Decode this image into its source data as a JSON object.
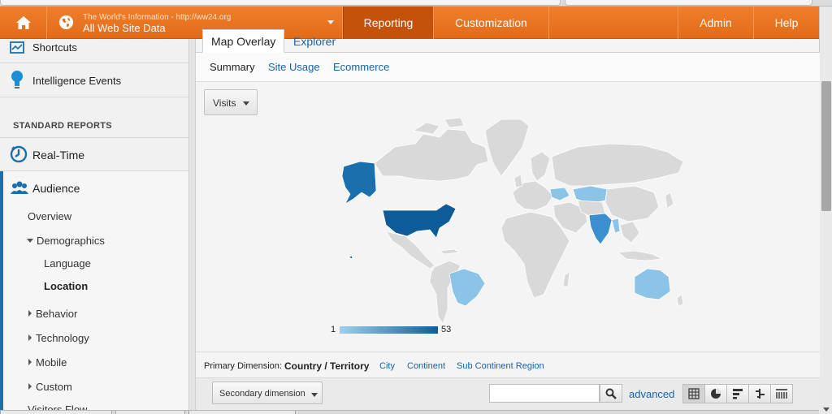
{
  "header": {
    "account_url": "The World's Information - http://ww24.org",
    "account_name": "All Web Site Data",
    "tabs": [
      {
        "label": "Reporting",
        "active": true
      },
      {
        "label": "Customization",
        "active": false
      }
    ],
    "right_tabs": [
      {
        "label": "Admin"
      },
      {
        "label": "Help"
      }
    ],
    "accent_color": "#e8731f",
    "active_tab_color": "#c4520a"
  },
  "sidebar": {
    "shortcuts": "Shortcuts",
    "intelligence_events": "Intelligence Events",
    "section_title": "STANDARD REPORTS",
    "realtime": "Real-Time",
    "audience": "Audience",
    "audience_items": {
      "overview": "Overview",
      "demographics": "Demographics",
      "language": "Language",
      "location": "Location",
      "behavior": "Behavior",
      "technology": "Technology",
      "mobile": "Mobile",
      "custom": "Custom",
      "visitors_flow": "Visitors Flow"
    },
    "selected_item": "Location"
  },
  "main": {
    "view_tabs": [
      {
        "label": "Map Overlay",
        "active": true
      },
      {
        "label": "Explorer",
        "active": false
      }
    ],
    "subtabs": [
      {
        "label": "Summary",
        "active": true
      },
      {
        "label": "Site Usage",
        "active": false
      },
      {
        "label": "Ecommerce",
        "active": false
      }
    ],
    "metric_select": "Visits",
    "legend": {
      "min": "1",
      "max": "53",
      "low_color": "#9fcfe9",
      "high_color": "#0a5f9e"
    },
    "highlighted_regions": [
      {
        "region": "United States",
        "level": "high"
      },
      {
        "region": "Alaska",
        "level": "high"
      },
      {
        "region": "Brazil",
        "level": "low"
      },
      {
        "region": "India",
        "level": "medium"
      },
      {
        "region": "Australia",
        "level": "low"
      },
      {
        "region": "Kazakhstan",
        "level": "low"
      },
      {
        "region": "Ukraine",
        "level": "low"
      },
      {
        "region": "Myanmar",
        "level": "low"
      }
    ],
    "primary_dimension": {
      "label": "Primary Dimension:",
      "selected": "Country / Territory",
      "options": [
        "City",
        "Continent",
        "Sub Continent Region"
      ]
    },
    "secondary_dimension": "Secondary dimension",
    "search_value": "",
    "advanced_link": "advanced"
  },
  "icons": {
    "home": "home-icon",
    "globe": "globe-icon",
    "search": "search-icon",
    "views": [
      "grid-view-icon",
      "pie-view-icon",
      "bar-view-icon",
      "comparison-view-icon",
      "pivot-view-icon"
    ]
  }
}
